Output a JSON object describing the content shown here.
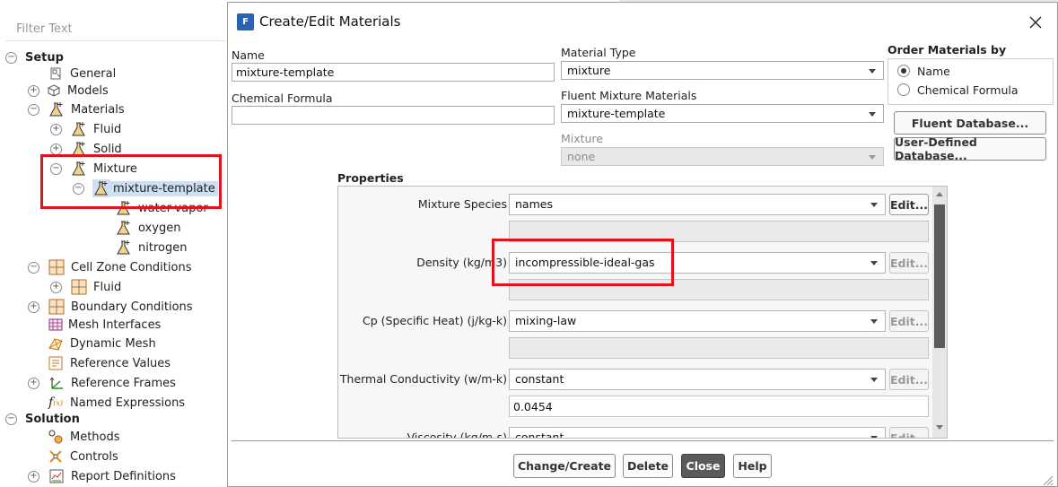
{
  "filter": {
    "placeholder": "Filter Text"
  },
  "tree": {
    "setup": "Setup",
    "general": "General",
    "models": "Models",
    "materials": "Materials",
    "fluid": "Fluid",
    "solid": "Solid",
    "mixture": "Mixture",
    "mixture_template": "mixture-template",
    "water_vapor": "water-vapor",
    "oxygen": "oxygen",
    "nitrogen": "nitrogen",
    "cell_zone_conditions": "Cell Zone Conditions",
    "cz_fluid": "Fluid",
    "boundary_conditions": "Boundary Conditions",
    "mesh_interfaces": "Mesh Interfaces",
    "dynamic_mesh": "Dynamic Mesh",
    "reference_values": "Reference Values",
    "reference_frames": "Reference Frames",
    "named_expressions": "Named Expressions",
    "solution": "Solution",
    "methods": "Methods",
    "controls": "Controls",
    "report_definitions": "Report Definitions"
  },
  "dialog": {
    "title": "Create/Edit Materials",
    "icon_letter": "F",
    "name_label": "Name",
    "name_value": "mixture-template",
    "formula_label": "Chemical Formula",
    "formula_value": "",
    "material_type_label": "Material Type",
    "material_type_value": "mixture",
    "fluent_mixture_label": "Fluent Mixture Materials",
    "fluent_mixture_value": "mixture-template",
    "mixture_label": "Mixture",
    "mixture_value": "none",
    "order_label": "Order Materials by",
    "order_name": "Name",
    "order_formula": "Chemical Formula",
    "fluent_db_button": "Fluent Database...",
    "user_db_button": "User-Defined Database...",
    "properties_label": "Properties",
    "properties": {
      "mixture_species_label": "Mixture Species",
      "mixture_species_value": "names",
      "density_label": "Density (kg/m3)",
      "density_value": "incompressible-ideal-gas",
      "cp_label": "Cp (Specific Heat) (j/kg-k)",
      "cp_value": "mixing-law",
      "thermal_label": "Thermal Conductivity (w/m-k)",
      "thermal_value": "constant",
      "thermal_number": "0.0454",
      "viscosity_label": "Viscosity (kg/m-s)",
      "viscosity_value": "constant",
      "edit": "Edit..."
    },
    "buttons": {
      "change_create": "Change/Create",
      "delete": "Delete",
      "close": "Close",
      "help": "Help"
    }
  },
  "colors": {
    "highlight_box": "#e0141e",
    "selection": "#cfdff2",
    "brand": "#2b62b4"
  }
}
